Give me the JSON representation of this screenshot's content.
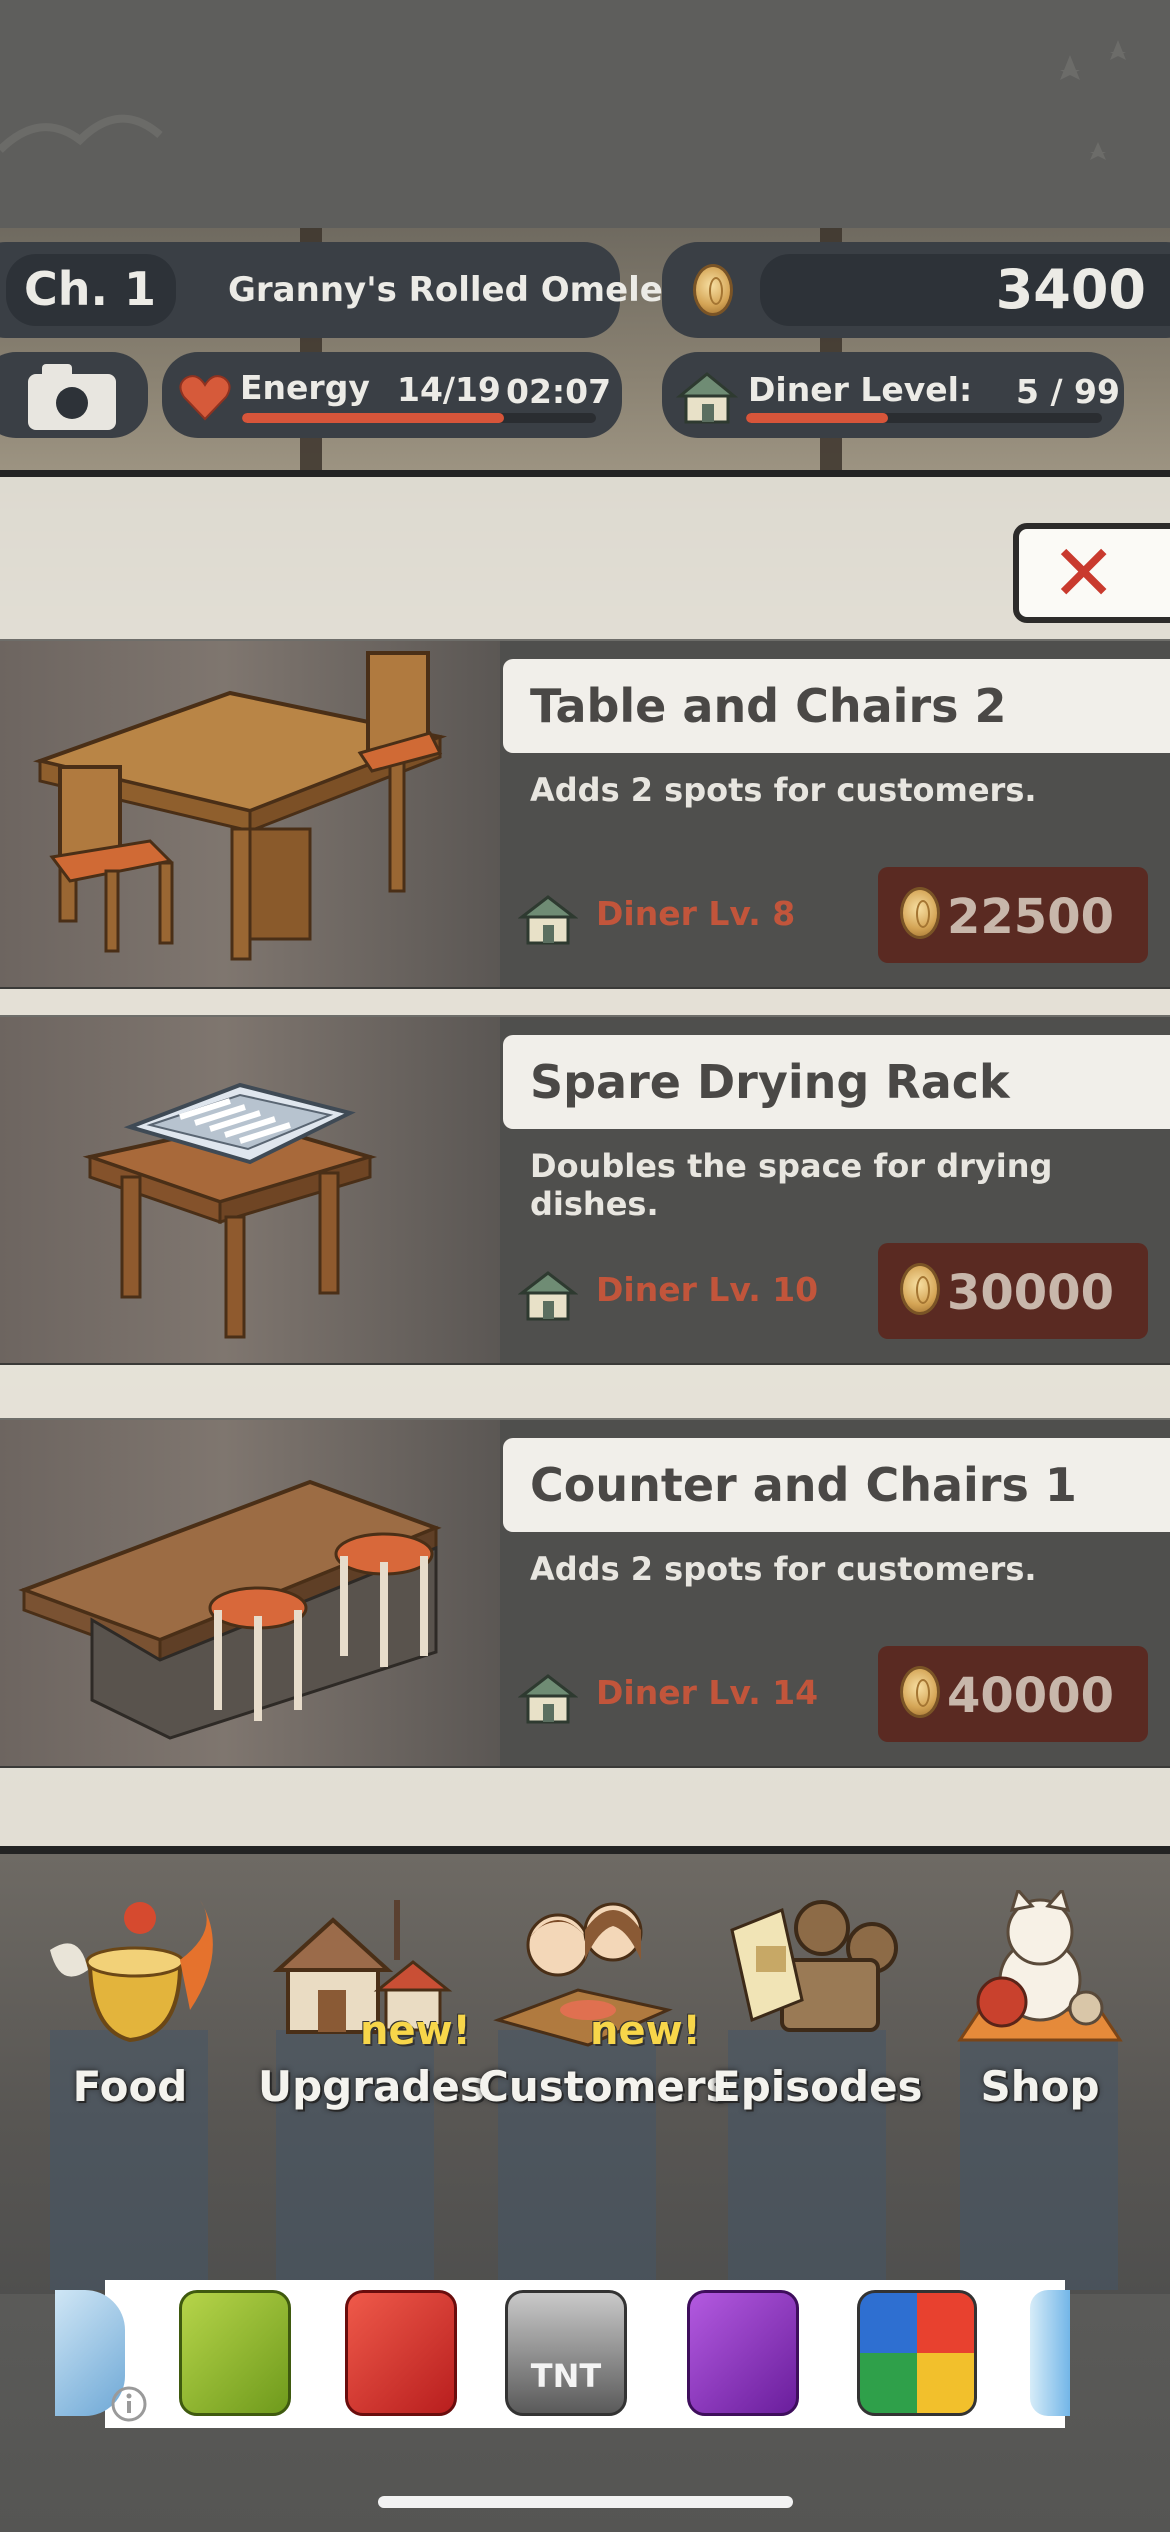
{
  "hud": {
    "chapter": "Ch. 1",
    "recipe": "Granny's Rolled Omelet",
    "coins": "3400",
    "energy_label": "Energy",
    "energy_value": "14/19",
    "energy_timer": "02:07",
    "energy_progress": 0.74,
    "diner_label": "Diner Level:",
    "diner_value": "5 / 99",
    "diner_progress": 0.4
  },
  "panel": {
    "close_icon": "close-x-icon",
    "items": [
      {
        "title": "Table and Chairs 2",
        "description": "Adds 2 spots for customers.",
        "requirement": "Diner Lv. 8",
        "price": "22500"
      },
      {
        "title": "Spare Drying Rack",
        "description": "Doubles the space for drying dishes.",
        "requirement": "Diner Lv. 10",
        "price": "30000"
      },
      {
        "title": "Counter and Chairs 1",
        "description": "Adds 2 spots for customers.",
        "requirement": "Diner Lv. 14",
        "price": "40000"
      }
    ]
  },
  "nav": {
    "food": "Food",
    "upgrades": "Upgrades",
    "customers": "Customers",
    "episodes": "Episodes",
    "shop": "Shop",
    "upgrades_badge": "new!",
    "customers_badge": "new!"
  },
  "ad": {
    "tnt_label": "TNT",
    "info_icon": "info-icon"
  },
  "colors": {
    "accent_red": "#d7553a",
    "price_bg": "#5a2a22",
    "requirement_text": "#c2553b",
    "badge_yellow": "#f7d64a"
  }
}
